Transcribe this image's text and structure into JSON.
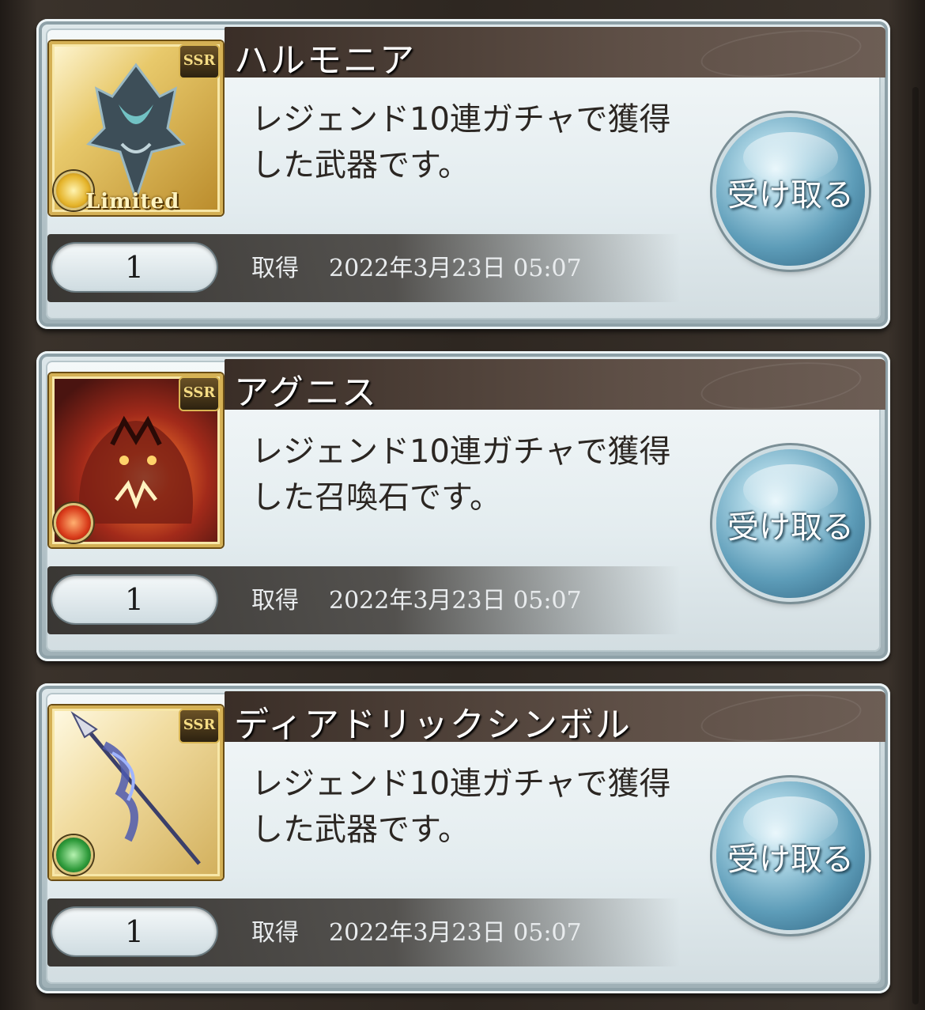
{
  "items": [
    {
      "name": "ハルモニア",
      "description": "レジェンド10連ガチャで獲得した武器です。",
      "rarity": "SSR",
      "element": "light",
      "limited_label": "Limited",
      "quantity": "1",
      "acquired_label": "取得",
      "acquired_date": "2022年3月23日 05:07",
      "button_label": "受け取る"
    },
    {
      "name": "アグニス",
      "description": "レジェンド10連ガチャで獲得した召喚石です。",
      "rarity": "SSR",
      "element": "fire",
      "quantity": "1",
      "acquired_label": "取得",
      "acquired_date": "2022年3月23日 05:07",
      "button_label": "受け取る"
    },
    {
      "name": "ディアドリックシンボル",
      "description": "レジェンド10連ガチャで獲得した武器です。",
      "rarity": "SSR",
      "element": "wind",
      "quantity": "1",
      "acquired_label": "取得",
      "acquired_date": "2022年3月23日 05:07",
      "button_label": "受け取る"
    }
  ],
  "colors": {
    "title_bar": "#3a2e27",
    "button_blue": "#5d9cb8",
    "card_frame": "#b9c8cd"
  }
}
